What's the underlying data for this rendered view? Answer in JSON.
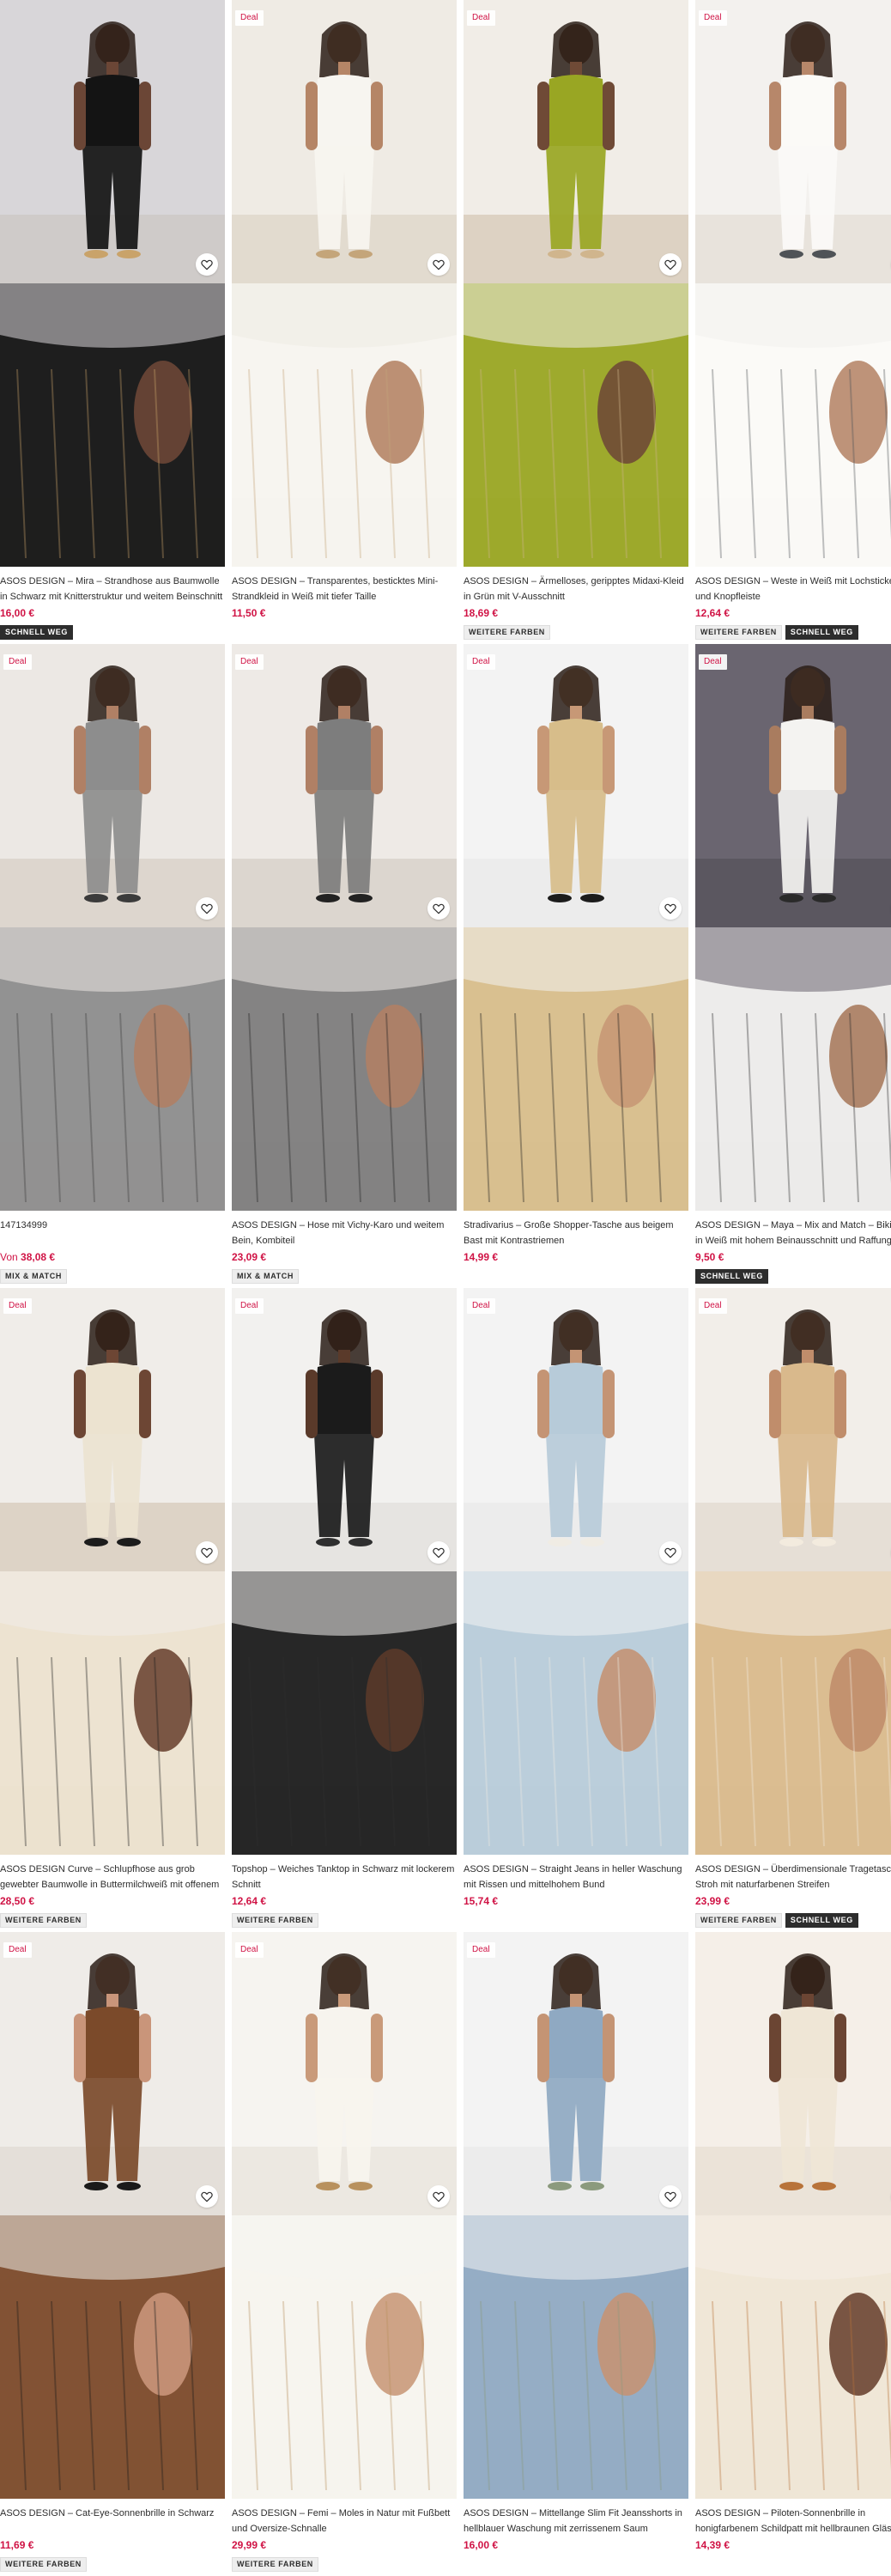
{
  "colors": {
    "accent": "#d01345",
    "text": "#2d2d2d",
    "badge_dark": "#2d2d2d",
    "badge_light": "#eeeeee"
  },
  "icons": {
    "wishlist": "heart-outline-icon"
  },
  "products": [
    {
      "deal": "",
      "title": "ASOS DESIGN – Mira – Strandhose aus Baumwolle in Schwarz mit Knitterstruktur und weitem Beinschnitt",
      "price_prefix": "",
      "price": "16,00 €",
      "badges": [
        "SCHNELL WEG"
      ],
      "badge_styles": [
        "dark"
      ],
      "scene": {
        "bg": "#d8d6d9",
        "garment": "#141414",
        "skin": "#6b4636",
        "floor": "#cfcbc9",
        "accent": "#c9a36a"
      }
    },
    {
      "deal": "Deal",
      "title": "ASOS DESIGN – Transparentes, besticktes Mini-Strandkleid in Weiß mit tiefer Taille",
      "price_prefix": "",
      "price": "11,50 €",
      "badges": [],
      "badge_styles": [],
      "scene": {
        "bg": "#efebe4",
        "garment": "#f7f5f0",
        "skin": "#b58566",
        "floor": "#e2dbcf",
        "accent": "#c4a57a"
      }
    },
    {
      "deal": "Deal",
      "title": "ASOS DESIGN – Ärmelloses, geripptes Midaxi-Kleid in Grün mit V-Ausschnitt",
      "price_prefix": "",
      "price": "18,69 €",
      "badges": [
        "WEITERE FARBEN"
      ],
      "badge_styles": [
        "light"
      ],
      "scene": {
        "bg": "#f1ede7",
        "garment": "#99a623",
        "skin": "#6f4a36",
        "floor": "#ddd2c3",
        "accent": "#d0b58d"
      }
    },
    {
      "deal": "Deal",
      "title": "ASOS DESIGN – Weste in Weiß mit Lochstickerei und Knopfleiste",
      "price_prefix": "",
      "price": "12,64 €",
      "badges": [
        "WEITERE FARBEN",
        "SCHNELL WEG"
      ],
      "badge_styles": [
        "light",
        "dark"
      ],
      "scene": {
        "bg": "#f3f1ee",
        "garment": "#fbfaf7",
        "skin": "#b7876a",
        "floor": "#e8e3dc",
        "accent": "#4f5357"
      }
    },
    {
      "deal": "Deal",
      "title": "147134999",
      "price_prefix": "Von",
      "price": "38,08 €",
      "badges": [
        "MIX & MATCH"
      ],
      "badge_styles": [
        "light"
      ],
      "scene": {
        "bg": "#ece8e4",
        "garment": "#8d8d8d",
        "skin": "#b08065",
        "floor": "#ddd6ce",
        "accent": "#3b3b3b"
      }
    },
    {
      "deal": "Deal",
      "title": "ASOS DESIGN – Hose mit Vichy-Karo und weitem Bein, Kombiteil",
      "price_prefix": "",
      "price": "23,09 €",
      "badges": [
        "MIX & MATCH"
      ],
      "badge_styles": [
        "light"
      ],
      "scene": {
        "bg": "#eeeae6",
        "garment": "#7d7d7d",
        "skin": "#b08065",
        "floor": "#dcd6cf",
        "accent": "#222222"
      }
    },
    {
      "deal": "Deal",
      "title": "Stradivarius – Große Shopper-Tasche aus beigem Bast mit Kontrastriemen",
      "price_prefix": "",
      "price": "14,99 €",
      "badges": [],
      "badge_styles": [],
      "scene": {
        "bg": "#f3f3f3",
        "garment": "#d7bd8a",
        "skin": "#c79876",
        "floor": "#ececec",
        "accent": "#1c1c1c"
      }
    },
    {
      "deal": "Deal",
      "title": "ASOS DESIGN – Maya – Mix and Match – Bikinihose in Weiß mit hohem Beinausschnitt und Raffung",
      "price_prefix": "",
      "price": "9,50 €",
      "badges": [
        "SCHNELL WEG"
      ],
      "badge_styles": [
        "dark"
      ],
      "scene": {
        "bg": "#6a6570",
        "garment": "#f4f3f1",
        "skin": "#a97c5f",
        "floor": "#5b5760",
        "accent": "#2a2a2a"
      }
    },
    {
      "deal": "Deal",
      "title": "ASOS DESIGN Curve – Schlupfhose aus grob gewebter Baumwolle in Buttermilchweiß mit offenem Saum",
      "price_prefix": "",
      "price": "28,50 €",
      "badges": [
        "WEITERE FARBEN"
      ],
      "badge_styles": [
        "light"
      ],
      "scene": {
        "bg": "#f0ede9",
        "garment": "#ece3d0",
        "skin": "#6d4634",
        "floor": "#ddd3c6",
        "accent": "#1c1c1c"
      }
    },
    {
      "deal": "Deal",
      "title": "Topshop – Weiches Tanktop in Schwarz mit lockerem Schnitt",
      "price_prefix": "",
      "price": "12,64 €",
      "badges": [
        "WEITERE FARBEN"
      ],
      "badge_styles": [
        "light"
      ],
      "scene": {
        "bg": "#f2f1ef",
        "garment": "#1b1b1b",
        "skin": "#5a3a2a",
        "floor": "#e6e4e1",
        "accent": "#2f2f2f"
      }
    },
    {
      "deal": "Deal",
      "title": "ASOS DESIGN – Straight Jeans in heller Waschung mit Rissen und mittelhohem Bund",
      "price_prefix": "",
      "price": "15,74 €",
      "badges": [],
      "badge_styles": [],
      "scene": {
        "bg": "#f3f3f3",
        "garment": "#b7cbd9",
        "skin": "#c49474",
        "floor": "#ececec",
        "accent": "#f0ece4"
      }
    },
    {
      "deal": "Deal",
      "title": "ASOS DESIGN – Überdimensionale Tragetasche aus Stroh mit naturfarbenen Streifen",
      "price_prefix": "",
      "price": "23,99 €",
      "badges": [
        "WEITERE FARBEN",
        "SCHNELL WEG"
      ],
      "badge_styles": [
        "light",
        "dark"
      ],
      "scene": {
        "bg": "#f2eee9",
        "garment": "#d9b98c",
        "skin": "#c08d6b",
        "floor": "#e6dfd6",
        "accent": "#f3ebde"
      }
    },
    {
      "deal": "Deal",
      "title": "ASOS DESIGN – Cat-Eye-Sonnenbrille in Schwarz",
      "price_prefix": "",
      "price": "11,69 €",
      "badges": [
        "WEITERE FARBEN"
      ],
      "badge_styles": [
        "light"
      ],
      "scene": {
        "bg": "#efece8",
        "garment": "#7b4a2a",
        "skin": "#c9957a",
        "floor": "#e4dfd9",
        "accent": "#1a1a1a"
      }
    },
    {
      "deal": "Deal",
      "title": "ASOS DESIGN – Femi – Moles in Natur mit Fußbett und Oversize-Schnalle",
      "price_prefix": "",
      "price": "29,99 €",
      "badges": [
        "WEITERE FARBEN"
      ],
      "badge_styles": [
        "light"
      ],
      "scene": {
        "bg": "#f6f4f0",
        "garment": "#f7f4ee",
        "skin": "#c99a7a",
        "floor": "#ece8e1",
        "accent": "#b8915e"
      }
    },
    {
      "deal": "Deal",
      "title": "ASOS DESIGN – Mittellange Slim Fit Jeansshorts in hellblauer Waschung mit zerrissenem Saum",
      "price_prefix": "",
      "price": "16,00 €",
      "badges": [],
      "badge_styles": [],
      "scene": {
        "bg": "#f3f3f3",
        "garment": "#8fa9c2",
        "skin": "#c49474",
        "floor": "#ececec",
        "accent": "#8b9a7d"
      }
    },
    {
      "deal": "",
      "title": "ASOS DESIGN – Piloten-Sonnenbrille in honigfarbenem Schildpatt mit hellbraunen Gläsern",
      "price_prefix": "",
      "price": "14,39 €",
      "badges": [],
      "badge_styles": [],
      "scene": {
        "bg": "#f5efe8",
        "garment": "#efe6d6",
        "skin": "#6b4533",
        "floor": "#ebe3d8",
        "accent": "#b8733a"
      }
    }
  ]
}
